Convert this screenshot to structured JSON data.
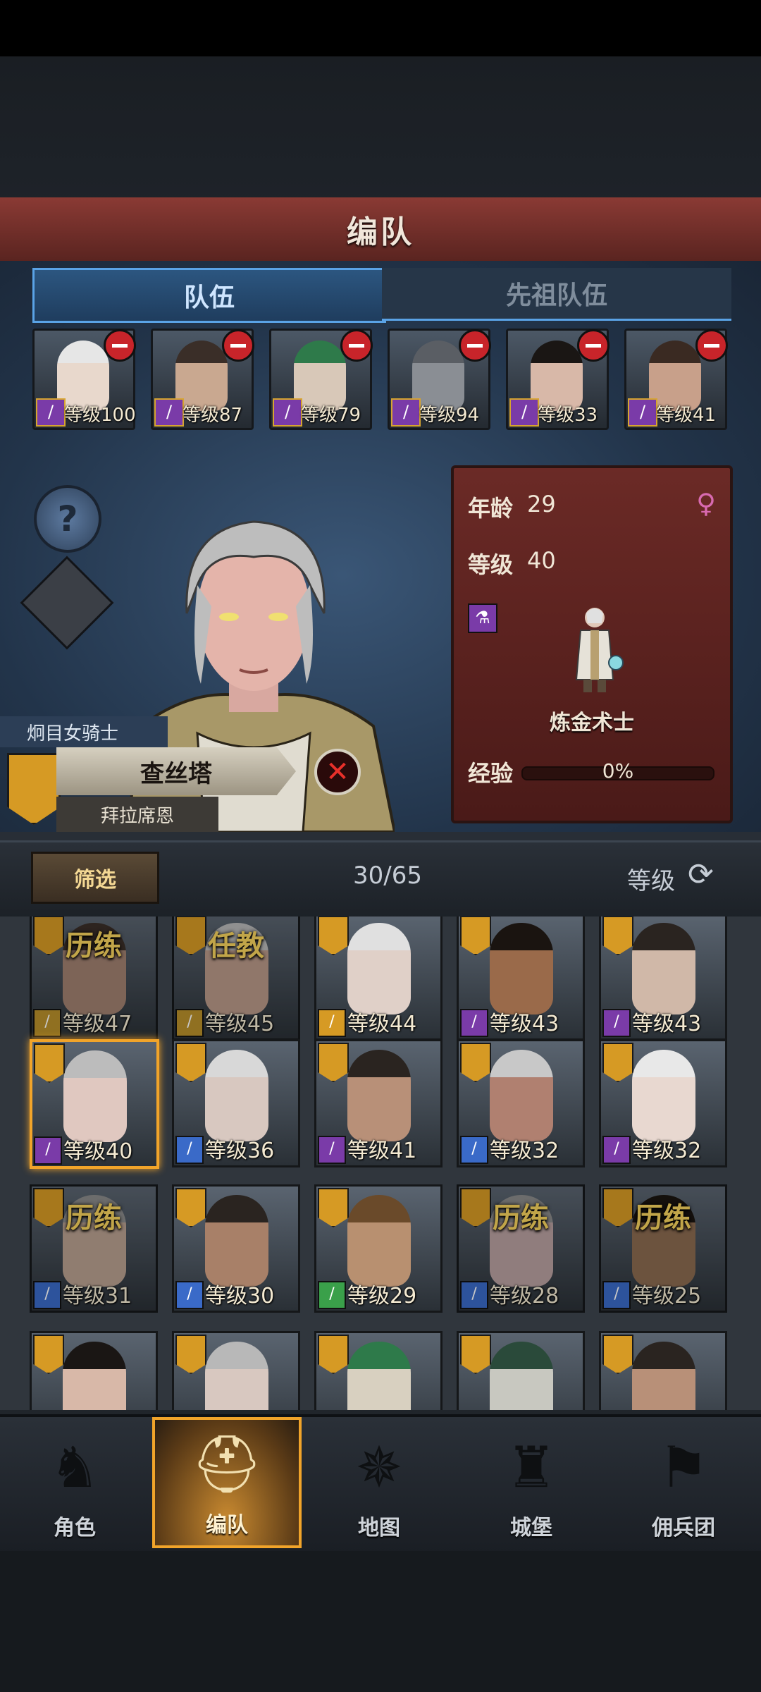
{
  "header": {
    "title": "编队"
  },
  "tabs": [
    {
      "label": "队伍"
    },
    {
      "label": "先祖队伍"
    }
  ],
  "team": [
    {
      "level": "等级100",
      "skin": "#e8d8cc",
      "hair": "#e6e6e6"
    },
    {
      "level": "等级87",
      "skin": "#c9a890",
      "hair": "#3a2e28"
    },
    {
      "level": "等级79",
      "skin": "#d8c8b8",
      "hair": "#2e7a4a"
    },
    {
      "level": "等级94",
      "skin": "#8a8e94",
      "hair": "#5a5e64"
    },
    {
      "level": "等级33",
      "skin": "#d8b8a8",
      "hair": "#1a1614"
    },
    {
      "level": "等级41",
      "skin": "#c8a08a",
      "hair": "#3a2a22"
    }
  ],
  "selected_hero": {
    "title": "炯目女骑士",
    "name": "查丝塔",
    "origin": "拜拉席恩",
    "age_label": "年龄",
    "age": "29",
    "level_label": "等级",
    "level": "40",
    "class_name": "炼金术士",
    "exp_label": "经验",
    "exp_text": "0%",
    "exp_progress": 0
  },
  "filter": {
    "button_label": "筛选",
    "count": "30/65",
    "sort_label": "等级"
  },
  "roster": [
    {
      "level": "等级47",
      "badge": "历练",
      "cls": "#b8902a",
      "skin": "#a08070",
      "hair": "#3a2e28",
      "dim": true
    },
    {
      "level": "等级45",
      "badge": "任教",
      "cls": "#b8902a",
      "skin": "#b89888",
      "hair": "#b8b8b8",
      "dim": true
    },
    {
      "level": "等级44",
      "badge": "",
      "cls": "#d69a24",
      "skin": "#e0d0c8",
      "hair": "#e0e0e0",
      "dim": false
    },
    {
      "level": "等级43",
      "badge": "",
      "cls": "#7a3ba8",
      "skin": "#9a6a4a",
      "hair": "#1a1410",
      "dim": false
    },
    {
      "level": "等级43",
      "badge": "",
      "cls": "#7a3ba8",
      "skin": "#d0b8a8",
      "hair": "#2a2420",
      "dim": false
    },
    {
      "level": "等级40",
      "badge": "",
      "cls": "#7a3ba8",
      "skin": "#e0c8c0",
      "hair": "#bcbcbc",
      "dim": false,
      "selected": true
    },
    {
      "level": "等级36",
      "badge": "",
      "cls": "#3a6ac8",
      "skin": "#d8c8c0",
      "hair": "#d8d8d8",
      "dim": false
    },
    {
      "level": "等级41",
      "badge": "",
      "cls": "#7a3ba8",
      "skin": "#b89078",
      "hair": "#2a2420",
      "dim": false
    },
    {
      "level": "等级32",
      "badge": "",
      "cls": "#3a6ac8",
      "skin": "#b08070",
      "hair": "#c8c8c8",
      "dim": false
    },
    {
      "level": "等级32",
      "badge": "",
      "cls": "#7a3ba8",
      "skin": "#e8d8d0",
      "hair": "#e8e8e8",
      "dim": false
    },
    {
      "level": "等级31",
      "badge": "历练",
      "cls": "#3a6ac8",
      "skin": "#b8a090",
      "hair": "#8a8a8a",
      "dim": true
    },
    {
      "level": "等级30",
      "badge": "",
      "cls": "#3a6ac8",
      "skin": "#a88068",
      "hair": "#2a2420",
      "dim": false
    },
    {
      "level": "等级29",
      "badge": "",
      "cls": "#3aa04a",
      "skin": "#b89070",
      "hair": "#6a4a2a",
      "dim": false
    },
    {
      "level": "等级28",
      "badge": "历练",
      "cls": "#3a6ac8",
      "skin": "#b8a0a0",
      "hair": "#8a8a8a",
      "dim": true
    },
    {
      "level": "等级25",
      "badge": "历练",
      "cls": "#3a6ac8",
      "skin": "#8a6a50",
      "hair": "#1a1410",
      "dim": true
    },
    {
      "level": "",
      "badge": "",
      "cls": "",
      "skin": "#d8b8a8",
      "hair": "#1a1614",
      "dim": false
    },
    {
      "level": "",
      "badge": "",
      "cls": "",
      "skin": "#d8c8c0",
      "hair": "#b8b8b8",
      "dim": false
    },
    {
      "level": "",
      "badge": "",
      "cls": "",
      "skin": "#d8d0c0",
      "hair": "#2e7a4a",
      "dim": false
    },
    {
      "level": "",
      "badge": "",
      "cls": "",
      "skin": "#c8c8c0",
      "hair": "#2a4a3a",
      "dim": false
    },
    {
      "level": "",
      "badge": "",
      "cls": "",
      "skin": "#b89078",
      "hair": "#2a2420",
      "dim": false
    }
  ],
  "nav": [
    {
      "label": "角色",
      "icon": "knight-icon"
    },
    {
      "label": "编队",
      "icon": "helmet-icon",
      "active": true
    },
    {
      "label": "地图",
      "icon": "compass-icon"
    },
    {
      "label": "城堡",
      "icon": "castle-icon"
    },
    {
      "label": "佣兵团",
      "icon": "banner-icon"
    }
  ],
  "colors": {
    "accent": "#f1a42a",
    "banner": "#8a3a34",
    "tab_active": "#5aa3e6",
    "remove": "#c8242a"
  }
}
